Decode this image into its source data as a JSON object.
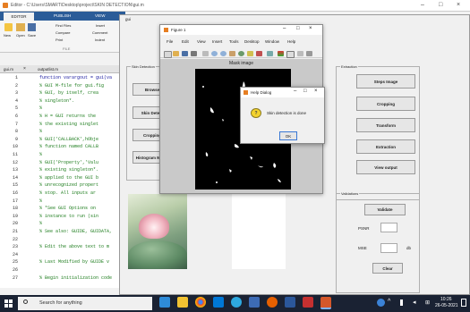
{
  "editor": {
    "title": "Editor - C:\\Users\\SMART\\Desktop\\project\\SKIN DETECTION\\gui.m",
    "tabs": [
      "EDITOR",
      "PUBLISH",
      "VIEW"
    ],
    "ribbon": {
      "find_files": "Find Files",
      "compare": "Compare",
      "print": "Print",
      "insert": "Insert",
      "comment": "Comment",
      "indent": "Indent",
      "new": "New",
      "open": "Open",
      "save": "Save",
      "group_file": "FILE"
    },
    "doc_tabs": [
      "gui.m",
      "outputlist.m"
    ],
    "lines": [
      {
        "n": "1",
        "t": "function varargout = gui(va",
        "kw": true
      },
      {
        "n": "2",
        "t": "% GUI M-file for gui.fig",
        "kw": false
      },
      {
        "n": "3",
        "t": "%      GUI, by itself, crea",
        "kw": false
      },
      {
        "n": "4",
        "t": "%      singleton*.",
        "kw": false
      },
      {
        "n": "5",
        "t": "%",
        "kw": false
      },
      {
        "n": "6",
        "t": "%      H = GUI returns the",
        "kw": false
      },
      {
        "n": "7",
        "t": "%      the existing singlet",
        "kw": false
      },
      {
        "n": "8",
        "t": "%",
        "kw": false
      },
      {
        "n": "9",
        "t": "%      GUI('CALLBACK',hObje",
        "kw": false
      },
      {
        "n": "10",
        "t": "%      function named CALLB",
        "kw": false
      },
      {
        "n": "11",
        "t": "%",
        "kw": false
      },
      {
        "n": "12",
        "t": "%      GUI('Property','Valu",
        "kw": false
      },
      {
        "n": "13",
        "t": "%      existing singleton*.",
        "kw": false
      },
      {
        "n": "14",
        "t": "%      applied to the GUI b",
        "kw": false
      },
      {
        "n": "15",
        "t": "%      unrecognized propert",
        "kw": false
      },
      {
        "n": "16",
        "t": "%      stop.  All inputs ar",
        "kw": false
      },
      {
        "n": "17",
        "t": "%",
        "kw": false
      },
      {
        "n": "18",
        "t": "%      *See GUI Options on",
        "kw": false
      },
      {
        "n": "19",
        "t": "%      instance to run (sin",
        "kw": false
      },
      {
        "n": "20",
        "t": "%",
        "kw": false
      },
      {
        "n": "21",
        "t": "% See also: GUIDE, GUIDATA,",
        "kw": false
      },
      {
        "n": "22",
        "t": "",
        "kw": false
      },
      {
        "n": "23",
        "t": "% Edit the above text to m",
        "kw": false
      },
      {
        "n": "24",
        "t": "",
        "kw": false
      },
      {
        "n": "25",
        "t": "% Last Modified by GUIDE v",
        "kw": false
      },
      {
        "n": "26",
        "t": "",
        "kw": false
      },
      {
        "n": "27",
        "t": "% Begin initialization code",
        "kw": false
      }
    ]
  },
  "gui": {
    "title": "gui",
    "skin_panel": "Skin Detection",
    "skin_buttons": [
      "Browse",
      "Skin Detect",
      "Cropping",
      "Histogram Match"
    ],
    "extraction_panel": "Extraction",
    "extraction_buttons": [
      "Steps Image",
      "Cropping",
      "Transform",
      "Extraction",
      "View output"
    ],
    "validations_panel": "Validations",
    "validate": "Validate",
    "psnr_label": "PSNR",
    "mse_label": "MSE",
    "db_label": "db",
    "clear": "Clear"
  },
  "figure": {
    "title": "Figure 1",
    "menu": [
      "File",
      "Edit",
      "View",
      "Insert",
      "Tools",
      "Desktop",
      "Window",
      "Help"
    ],
    "axes_title": "Mask image"
  },
  "dialog": {
    "title": "Help Dialog",
    "message": "Skin detection is done",
    "ok": "OK"
  },
  "taskbar": {
    "search_placeholder": "Search for anything",
    "time": "10:26",
    "date": "26-05-2021"
  }
}
